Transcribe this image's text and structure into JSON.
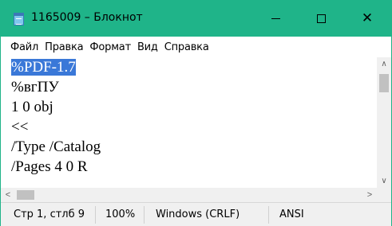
{
  "window": {
    "title": "1165009 – Блокнот",
    "accent_color": "#1fb489",
    "controls": {
      "minimize_icon": "minimize-icon",
      "maximize_icon": "maximize-icon",
      "close_icon": "close-icon",
      "close_glyph": "✕"
    }
  },
  "menu": {
    "items": [
      {
        "label": "Файл"
      },
      {
        "label": "Правка"
      },
      {
        "label": "Формат"
      },
      {
        "label": "Вид"
      },
      {
        "label": "Справка"
      }
    ]
  },
  "editor": {
    "selection_color": "#3a78d8",
    "lines": [
      {
        "text": "%PDF-1.7",
        "selected": true
      },
      {
        "text": "%вгПУ",
        "selected": false
      },
      {
        "text": "1 0 obj",
        "selected": false
      },
      {
        "text": "<<",
        "selected": false
      },
      {
        "text": "/Type /Catalog",
        "selected": false
      },
      {
        "text": "/Pages 4 0 R",
        "selected": false
      }
    ]
  },
  "scrollbars": {
    "up_glyph": "∧",
    "down_glyph": "∨",
    "left_glyph": "<",
    "right_glyph": ">"
  },
  "status": {
    "position": "Стр 1, стлб 9",
    "zoom": "100%",
    "line_endings": "Windows (CRLF)",
    "encoding": "ANSI"
  }
}
